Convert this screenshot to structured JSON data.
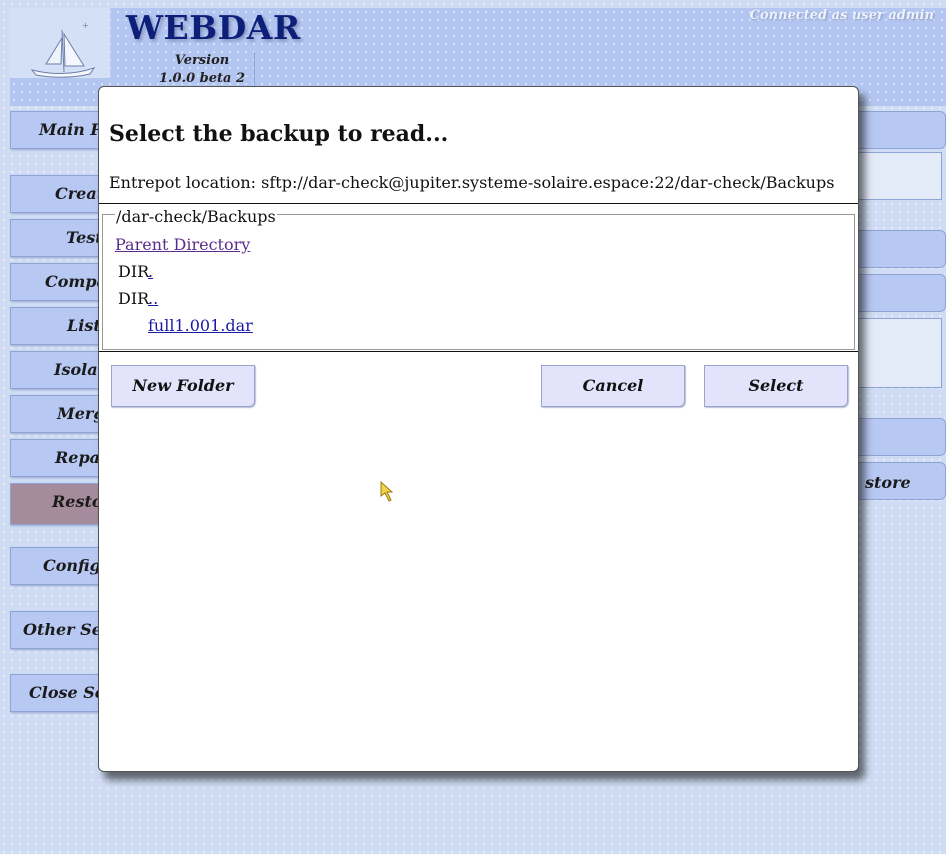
{
  "app": {
    "title": "WEBDAR",
    "version_label": "Version",
    "version_value": "1.0.0 beta 2",
    "connected_text": "Connected as user admin"
  },
  "sidebar": {
    "items": [
      {
        "label": "Main Page"
      },
      {
        "label": "Create"
      },
      {
        "label": "Test"
      },
      {
        "label": "Compare"
      },
      {
        "label": "List"
      },
      {
        "label": "Isolate"
      },
      {
        "label": "Merge"
      },
      {
        "label": "Repair"
      },
      {
        "label": "Restore",
        "active": true
      },
      {
        "label": "Configure"
      },
      {
        "label": "Other Sessions"
      },
      {
        "label": "Close Session"
      }
    ]
  },
  "right_partial": {
    "restore_label": "store"
  },
  "dialog": {
    "title": "Select the backup to read...",
    "entrepot_label": "Entrepot location:",
    "entrepot_value": "sftp://dar-check@jupiter.systeme-solaire.espace:22/dar-check/Backups",
    "current_path": "/dar-check/Backups",
    "parent_link": "Parent Directory",
    "entries": [
      {
        "type": "DIR",
        "name": "."
      },
      {
        "type": "DIR",
        "name": ".."
      },
      {
        "type": "",
        "name": "full1.001.dar"
      }
    ],
    "buttons": {
      "new_folder": "New Folder",
      "cancel": "Cancel",
      "select": "Select"
    }
  },
  "colors": {
    "page_bg": "#cfdcf4",
    "title_blue": "#0e1f7a",
    "active_sidebar": "#a58c9d",
    "button_bg": "#e3e4fb",
    "visited_link": "#5b2d8a",
    "link": "#1a1aa6"
  }
}
